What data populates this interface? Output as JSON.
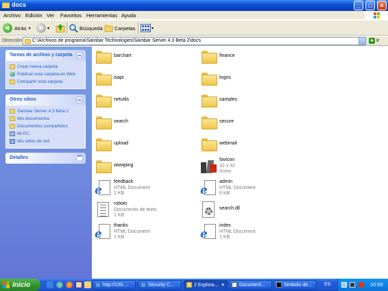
{
  "window": {
    "title": "docs",
    "buttons": {
      "minimize": "_",
      "maximize": "□",
      "close": "×"
    }
  },
  "menu": [
    "Archivo",
    "Edición",
    "Ver",
    "Favoritos",
    "Herramientas",
    "Ayuda"
  ],
  "toolbar": {
    "back_label": "Atrás",
    "search_label": "Búsqueda",
    "folders_label": "Carpetas"
  },
  "address": {
    "label": "Dirección",
    "value": "C:\\Archivos de programa\\Sambar Technologies\\Sambar Server 4.3 Beta 2\\docs",
    "go_label": "Ir"
  },
  "panels": {
    "tasks": {
      "title": "Tareas de archivo y carpeta",
      "items": [
        "Crear nueva carpeta",
        "Publicar esta carpeta en Web",
        "Compartir esta carpeta"
      ]
    },
    "places": {
      "title": "Otros sitios",
      "items": [
        "Sambar Server 4.3 Beta 2",
        "Mis documentos",
        "Documentos compartidos",
        "Mi PC",
        "Mis sitios de red"
      ]
    },
    "details": {
      "title": "Detalles"
    }
  },
  "files": {
    "barchart": {
      "name": "barchart"
    },
    "finance": {
      "name": "finance"
    },
    "isapi": {
      "name": "isapi"
    },
    "logos": {
      "name": "logos"
    },
    "netutils": {
      "name": "netutils"
    },
    "samples": {
      "name": "samples"
    },
    "search": {
      "name": "search"
    },
    "secure": {
      "name": "secure"
    },
    "upload": {
      "name": "upload"
    },
    "webmail": {
      "name": "webmail"
    },
    "wwwping": {
      "name": "wwwping"
    },
    "favicon": {
      "name": "favicon",
      "line2": "32 x 32",
      "line3": "Icono"
    },
    "feedback": {
      "name": "feedback",
      "line2": "HTML Document",
      "line3": "2 KB"
    },
    "admin": {
      "name": "admin",
      "line2": "HTML Document",
      "line3": "6 KB"
    },
    "robots": {
      "name": "robots",
      "line2": "Documento de texto",
      "line3": "1 KB"
    },
    "searchdll": {
      "name": "search.dll"
    },
    "thanks": {
      "name": "thanks",
      "line2": "HTML Document",
      "line3": "1 KB"
    },
    "index": {
      "name": "index",
      "line2": "HTML Document",
      "line3": "1 KB"
    }
  },
  "taskbar": {
    "start_label": "Inicio",
    "tasks": [
      "http://155....",
      "Security C...",
      "2 Explora...",
      "Document...",
      "Simbolo de..."
    ],
    "language": "ES",
    "clock": "10:55"
  }
}
